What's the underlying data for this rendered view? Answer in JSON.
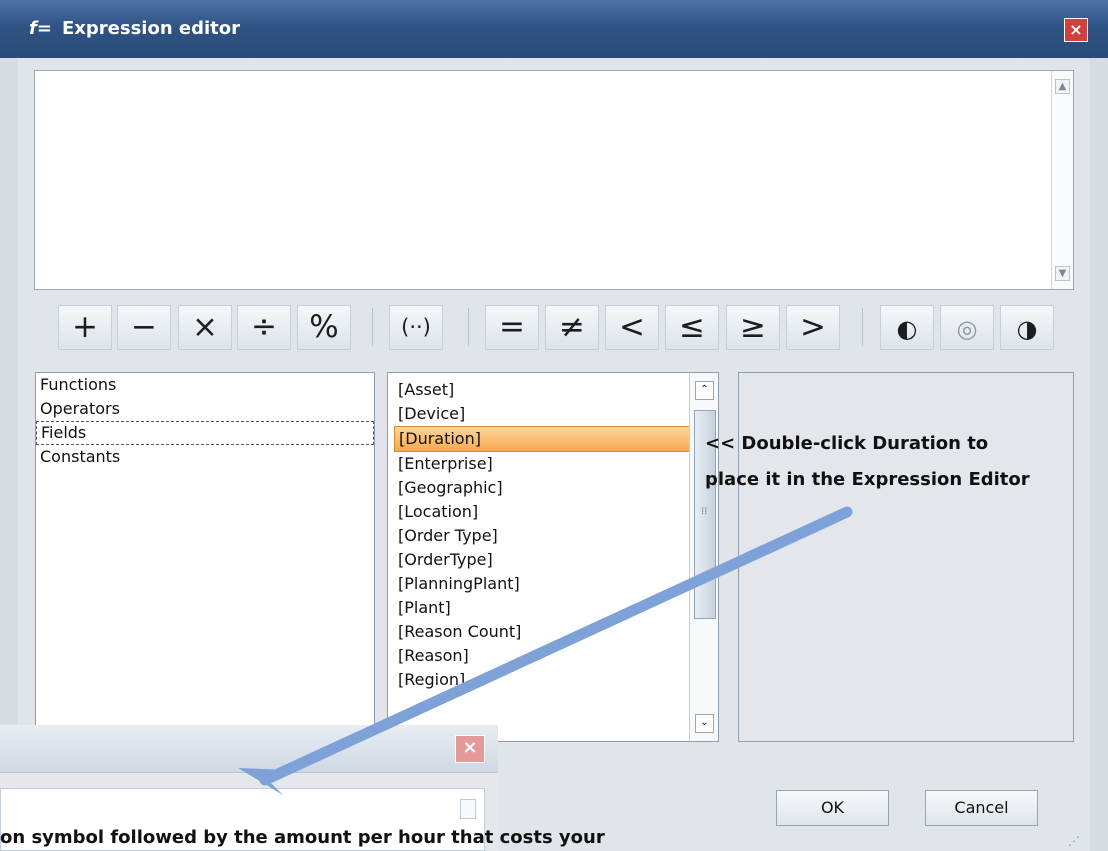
{
  "window": {
    "title": "Expression editor",
    "icon": "function-icon"
  },
  "operators": [
    "+",
    "−",
    "×",
    "÷",
    "%",
    "(··)",
    "=",
    "≠",
    "<",
    "≤",
    "≥",
    ">"
  ],
  "logic": [
    "and-logic-icon",
    "or-logic-icon",
    "not-logic-icon"
  ],
  "categories": [
    "Functions",
    "Operators",
    "Fields",
    "Constants"
  ],
  "fields": [
    "[Asset]",
    "[Device]",
    "[Duration]",
    "[Enterprise]",
    "[Geographic]",
    "[Location]",
    "[Order Type]",
    "[OrderType]",
    "[PlanningPlant]",
    "[Plant]",
    "[Reason Count]",
    "[Reason]",
    "[Region]"
  ],
  "annotation": {
    "line1": "<< Double-click Duration to",
    "line2": "place it in the Expression Editor"
  },
  "buttons": {
    "ok": "OK",
    "cancel": "Cancel"
  },
  "secondary_dialog": {
    "text": "on symbol followed by the amount per hour that costs your"
  }
}
